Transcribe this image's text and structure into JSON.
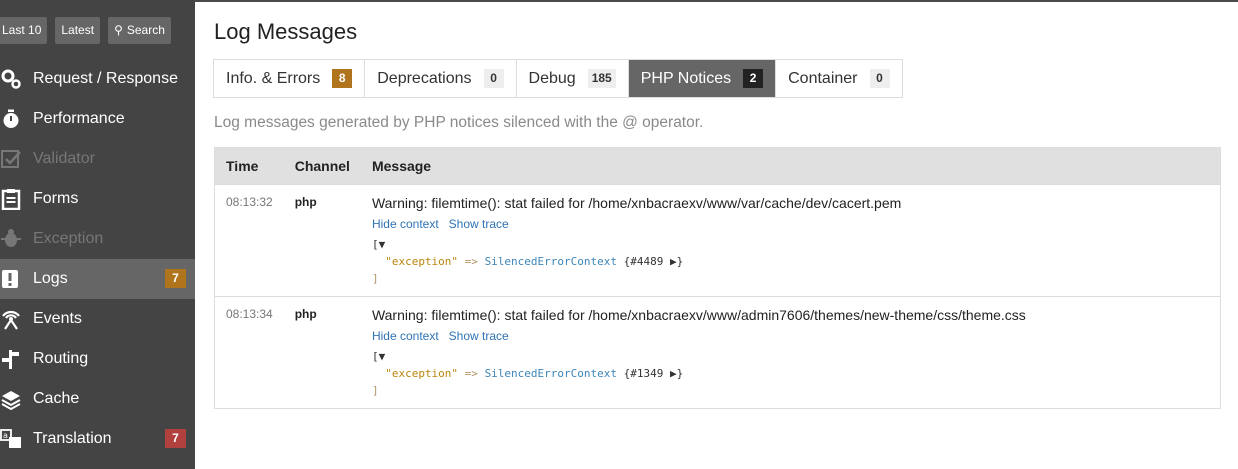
{
  "sidebar": {
    "buttons": {
      "last10": "Last 10",
      "latest": "Latest",
      "search": "Search"
    },
    "items": [
      {
        "label": "Request / Response",
        "icon": "cogs-icon",
        "state": "normal",
        "count": ""
      },
      {
        "label": "Performance",
        "icon": "stopwatch-icon",
        "state": "normal",
        "count": ""
      },
      {
        "label": "Validator",
        "icon": "checkbox-icon",
        "state": "disabled",
        "count": ""
      },
      {
        "label": "Forms",
        "icon": "clipboard-icon",
        "state": "normal",
        "count": ""
      },
      {
        "label": "Exception",
        "icon": "bug-icon",
        "state": "disabled",
        "count": ""
      },
      {
        "label": "Logs",
        "icon": "alert-icon",
        "state": "active",
        "count": "7",
        "count_color": "#b0741c"
      },
      {
        "label": "Events",
        "icon": "broadcast-icon",
        "state": "normal",
        "count": ""
      },
      {
        "label": "Routing",
        "icon": "signpost-icon",
        "state": "normal",
        "count": ""
      },
      {
        "label": "Cache",
        "icon": "layers-icon",
        "state": "normal",
        "count": ""
      },
      {
        "label": "Translation",
        "icon": "translate-icon",
        "state": "normal",
        "count": "7",
        "count_color": "#b0413e"
      }
    ]
  },
  "main": {
    "title": "Log Messages",
    "tabs": [
      {
        "label": "Info. & Errors",
        "count": "8",
        "active": false,
        "count_color": "#b0741c"
      },
      {
        "label": "Deprecations",
        "count": "0",
        "active": false
      },
      {
        "label": "Debug",
        "count": "185",
        "active": false
      },
      {
        "label": "PHP Notices",
        "count": "2",
        "active": true
      },
      {
        "label": "Container",
        "count": "0",
        "active": false
      }
    ],
    "description": "Log messages generated by PHP notices silenced with the @ operator.",
    "table": {
      "headers": [
        "Time",
        "Channel",
        "Message"
      ],
      "rows": [
        {
          "time": "08:13:32",
          "channel": "php",
          "message": "Warning: filemtime(): stat failed for /home/xnbacraexv/www/var/cache/dev/cacert.pem",
          "hide_context": "Hide context",
          "show_trace": "Show trace",
          "dump_open": "[▼",
          "dump_key": "\"exception\"",
          "dump_arrow": " => ",
          "dump_class": "SilencedErrorContext",
          "dump_ref": "{#4489 ▶}",
          "dump_close": "]"
        },
        {
          "time": "08:13:34",
          "channel": "php",
          "message": "Warning: filemtime(): stat failed for /home/xnbacraexv/www/admin7606/themes/new-theme/css/theme.css",
          "hide_context": "Hide context",
          "show_trace": "Show trace",
          "dump_open": "[▼",
          "dump_key": "\"exception\"",
          "dump_arrow": " => ",
          "dump_class": "SilencedErrorContext",
          "dump_ref": "{#1349 ▶}",
          "dump_close": "]"
        }
      ]
    }
  }
}
